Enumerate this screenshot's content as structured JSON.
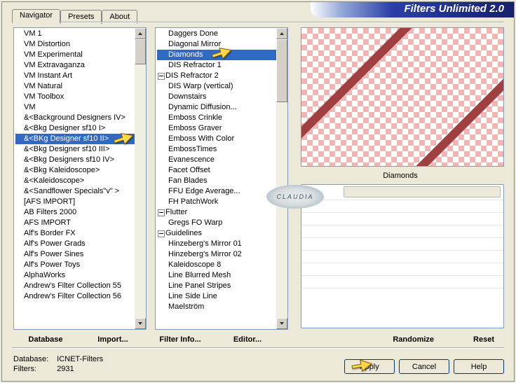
{
  "title": "Filters Unlimited 2.0",
  "tabs": [
    "Navigator",
    "Presets",
    "About"
  ],
  "active_tab": 0,
  "list1": [
    "VM 1",
    "VM Distortion",
    "VM Experimental",
    "VM Extravaganza",
    "VM Instant Art",
    "VM Natural",
    "VM Toolbox",
    "VM",
    "&<Background Designers IV>",
    "&<Bkg Designer sf10 I>",
    "&<BKg Designer sf10 II>",
    "&<Bkg Designer sf10 III>",
    "&<Bkg Designers sf10 IV>",
    "&<Bkg Kaleidoscope>",
    "&<Kaleidoscope>",
    "&<Sandflower Specials\"v\" >",
    "[AFS IMPORT]",
    "AB Filters 2000",
    "AFS IMPORT",
    "Alf's Border FX",
    "Alf's Power Grads",
    "Alf's Power Sines",
    "Alf's Power Toys",
    "AlphaWorks",
    "Andrew's Filter Collection 55",
    "Andrew's Filter Collection 56"
  ],
  "list1_selected": 10,
  "list2": [
    {
      "t": "Daggers Done"
    },
    {
      "t": "Diagonal Mirror"
    },
    {
      "t": "Diamonds",
      "sel": true
    },
    {
      "t": "DIS Refractor 1"
    },
    {
      "t": "DIS Refractor 2",
      "minus": true
    },
    {
      "t": "DIS Warp (vertical)"
    },
    {
      "t": "Downstairs"
    },
    {
      "t": "Dynamic Diffusion..."
    },
    {
      "t": "Emboss Crinkle"
    },
    {
      "t": "Emboss Graver"
    },
    {
      "t": "Emboss With Color"
    },
    {
      "t": "EmbossTimes"
    },
    {
      "t": "Evanescence"
    },
    {
      "t": "Facet Offset"
    },
    {
      "t": "Fan Blades"
    },
    {
      "t": "FFU Edge Average..."
    },
    {
      "t": "FH PatchWork"
    },
    {
      "t": "Flutter",
      "minus": true
    },
    {
      "t": "Gregs FO Warp"
    },
    {
      "t": "Guidelines",
      "minus": true
    },
    {
      "t": "Hinzeberg's Mirror 01"
    },
    {
      "t": "Hinzeberg's Mirror 02"
    },
    {
      "t": "Kaleidoscope 8"
    },
    {
      "t": "Line Blurred Mesh"
    },
    {
      "t": "Line Panel Stripes"
    },
    {
      "t": "Line Side Line"
    },
    {
      "t": "Maelström"
    }
  ],
  "btnrow": [
    "Database",
    "Import...",
    "Filter Info...",
    "Editor..."
  ],
  "btnrow2": [
    "Randomize",
    "Reset"
  ],
  "preview_label": "Diamonds",
  "info": {
    "db_label": "Database:",
    "db": "ICNET-Filters",
    "f_label": "Filters:",
    "f": "2931"
  },
  "buttons": [
    "Apply",
    "Cancel",
    "Help"
  ],
  "watermark": "CLAUDIA"
}
